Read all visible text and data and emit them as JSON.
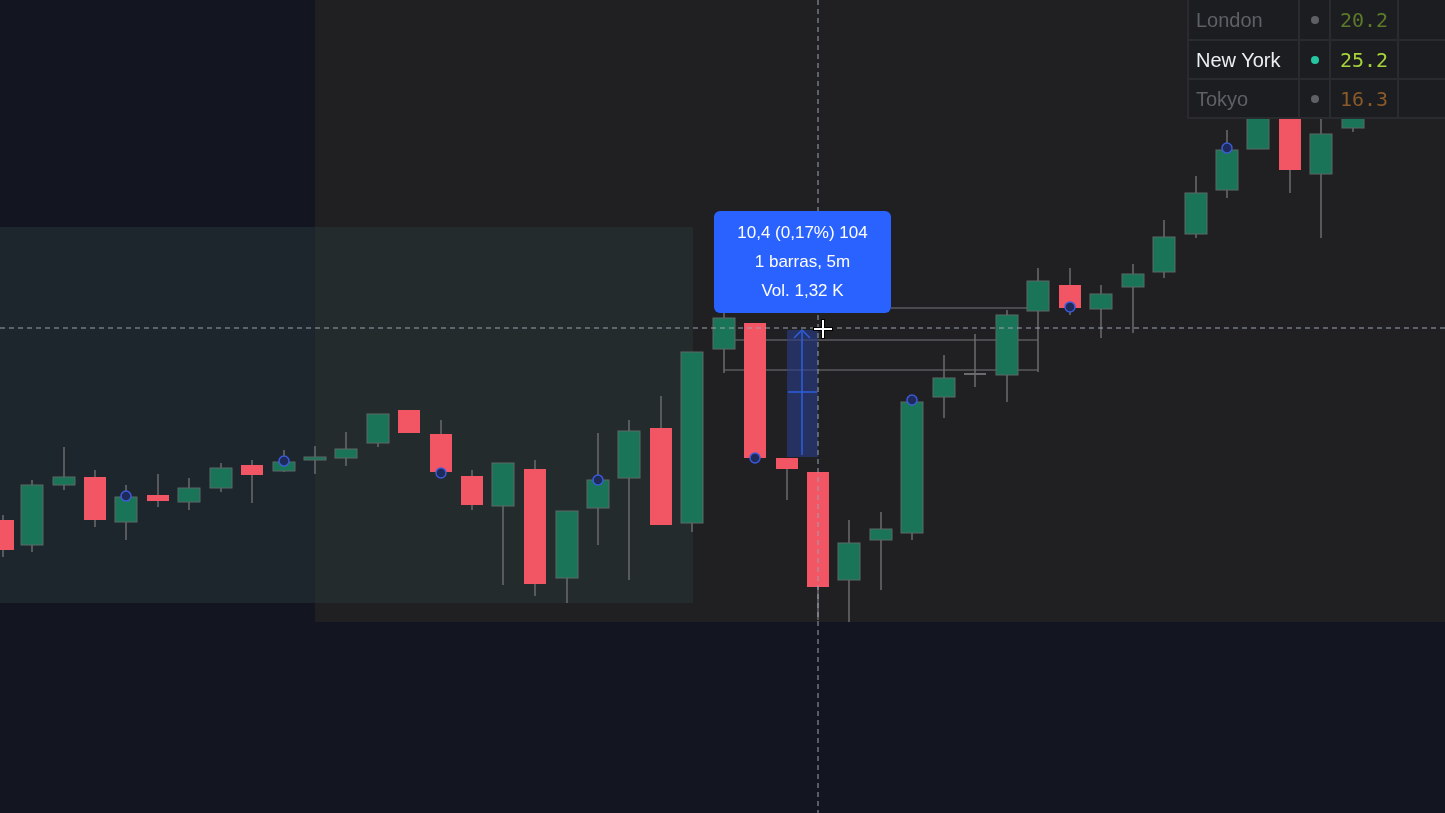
{
  "sessions_table": [
    {
      "name": "London",
      "selected": false,
      "value": "20.2",
      "color": "#5d7a2a"
    },
    {
      "name": "New York",
      "selected": true,
      "value": "25.2",
      "color": "#a6d43a"
    },
    {
      "name": "Tokyo",
      "selected": false,
      "value": "16.3",
      "color": "#8a5a28"
    }
  ],
  "measure_tooltip": {
    "lines": [
      "10,4 (0,17%) 104",
      "1 barras, 5m",
      "Vol. 1,32 K"
    ]
  }
}
